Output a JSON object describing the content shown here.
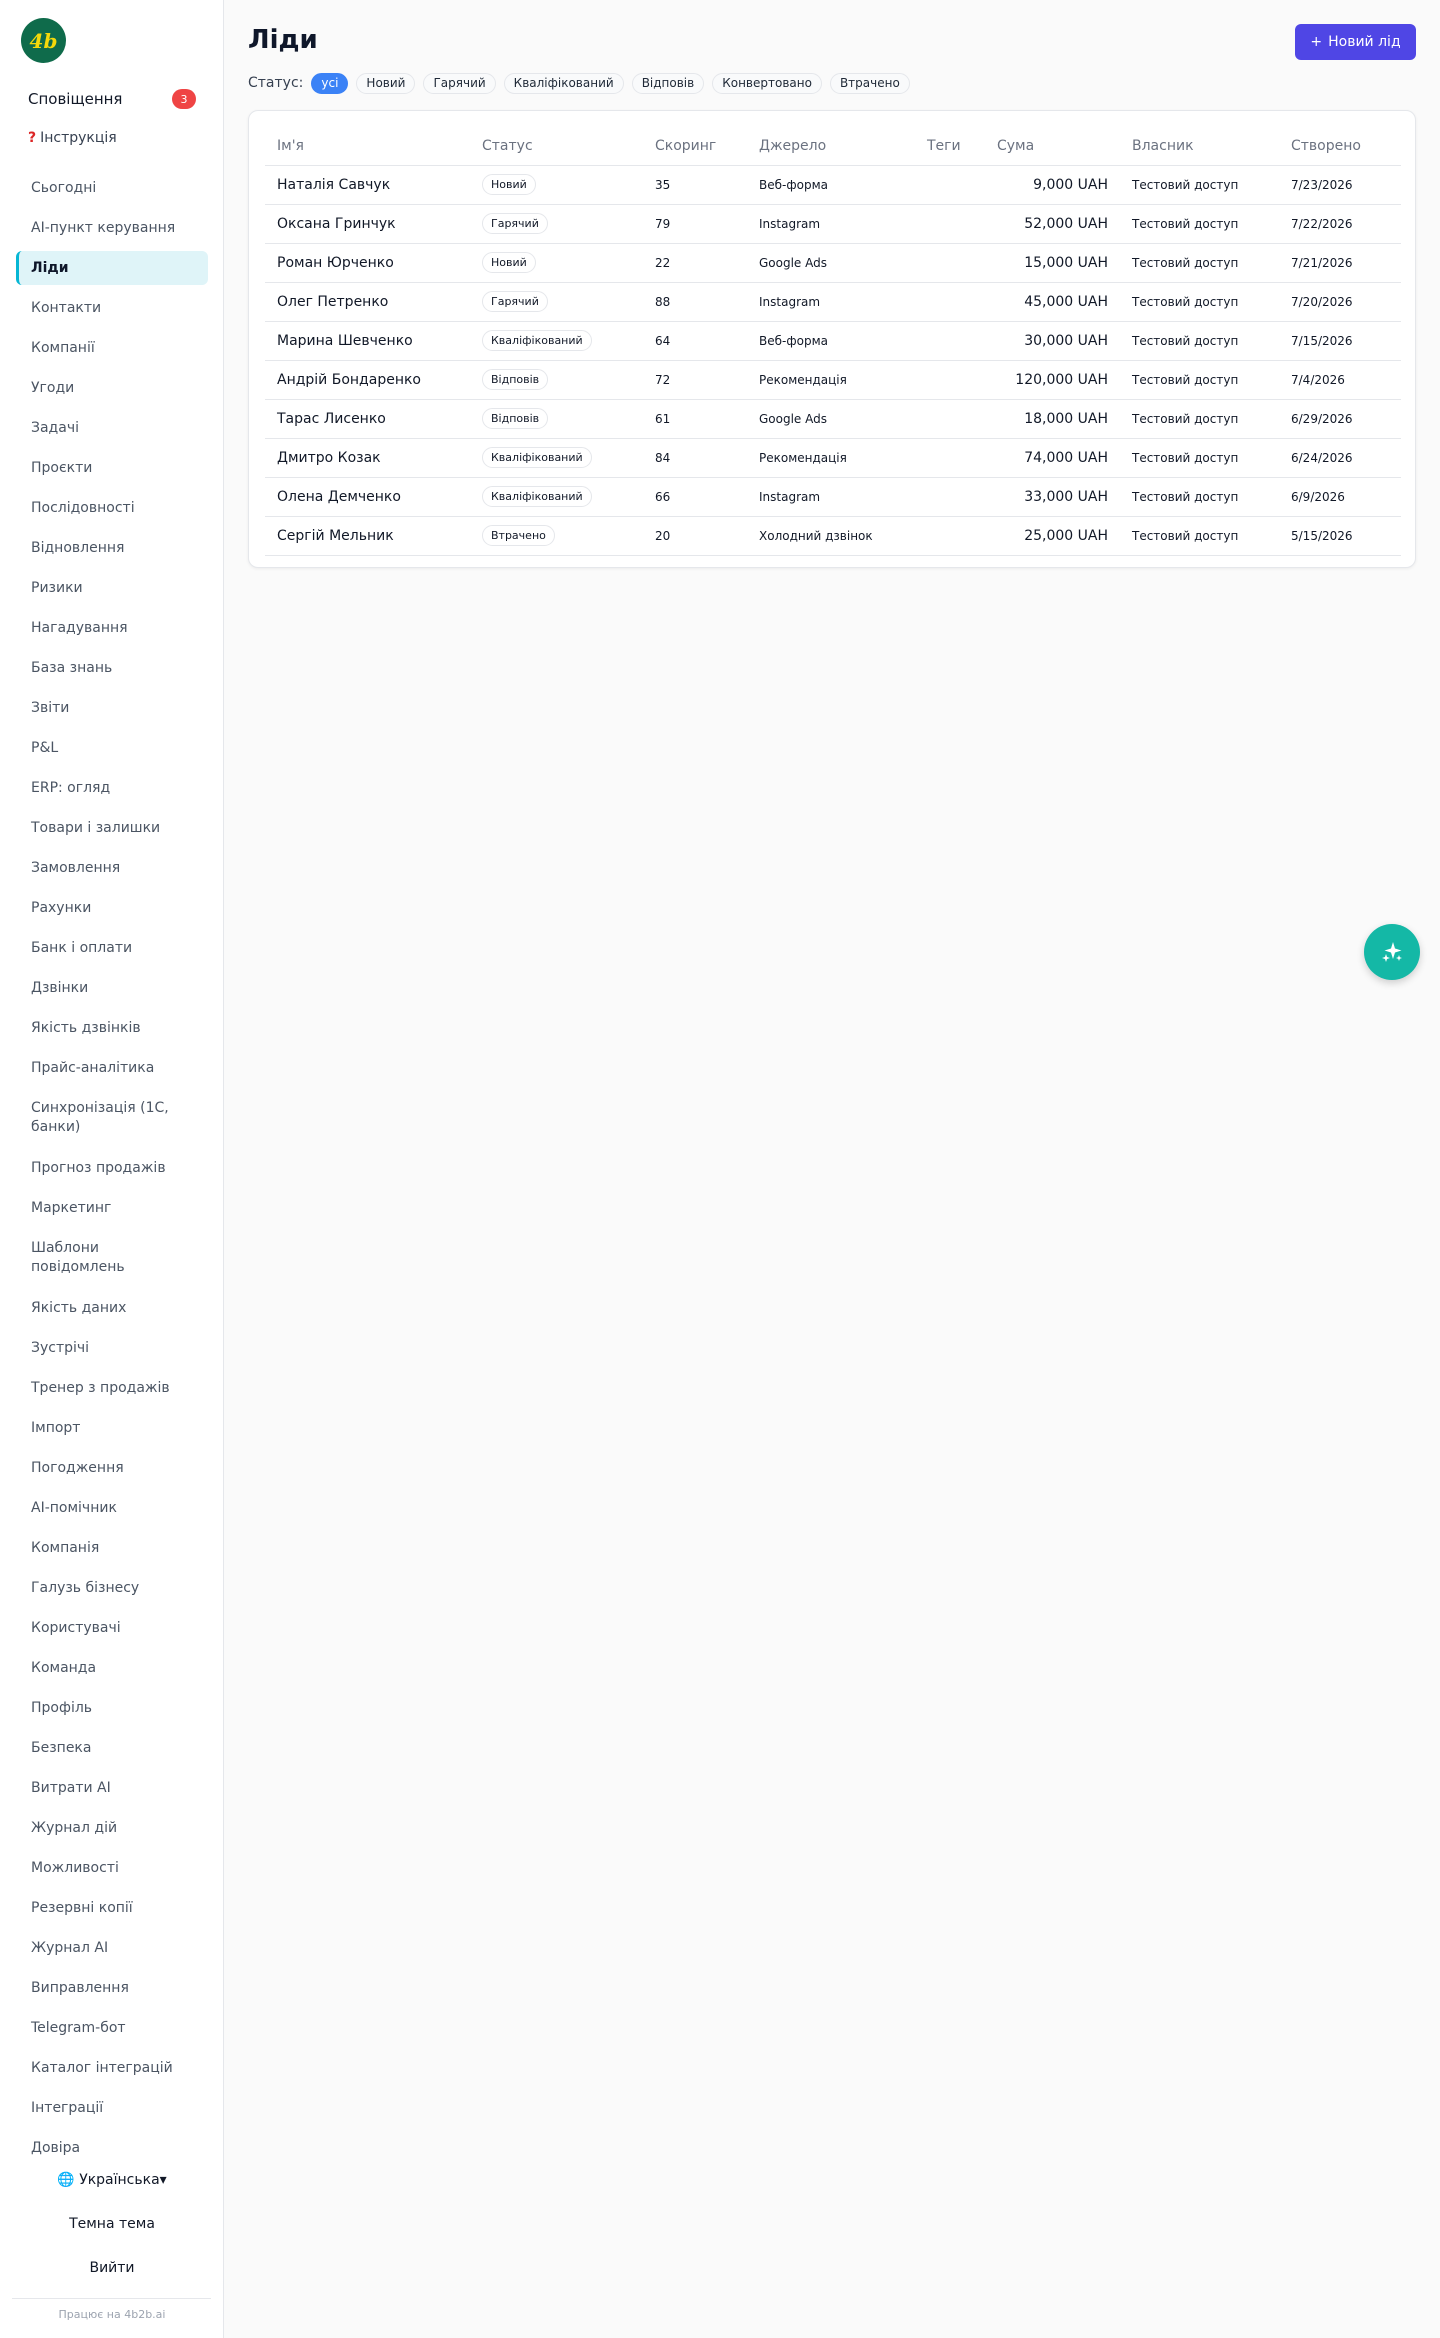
{
  "sidebar": {
    "logo_text": "4b",
    "notifications_label": "Сповіщення",
    "notifications_count": "3",
    "instruction_icon": "?",
    "instruction_label": "Інструкція",
    "items": [
      {
        "label": "Сьогодні"
      },
      {
        "label": "AI-пункт керування"
      },
      {
        "label": "Ліди",
        "active": true
      },
      {
        "label": "Контакти"
      },
      {
        "label": "Компанії"
      },
      {
        "label": "Угоди"
      },
      {
        "label": "Задачі"
      },
      {
        "label": "Проєкти"
      },
      {
        "label": "Послідовності"
      },
      {
        "label": "Відновлення"
      },
      {
        "label": "Ризики"
      },
      {
        "label": "Нагадування"
      },
      {
        "label": "База знань"
      },
      {
        "label": "Звіти"
      },
      {
        "label": "P&L"
      },
      {
        "label": "ERP: огляд"
      },
      {
        "label": "Товари і залишки"
      },
      {
        "label": "Замовлення"
      },
      {
        "label": "Рахунки"
      },
      {
        "label": "Банк і оплати"
      },
      {
        "label": "Дзвінки"
      },
      {
        "label": "Якість дзвінків"
      },
      {
        "label": "Прайс-аналітика"
      },
      {
        "label": "Синхронізація (1С, банки)"
      },
      {
        "label": "Прогноз продажів"
      },
      {
        "label": "Маркетинг"
      },
      {
        "label": "Шаблони повідомлень"
      },
      {
        "label": "Якість даних"
      },
      {
        "label": "Зустрічі"
      },
      {
        "label": "Тренер з продажів"
      },
      {
        "label": "Імпорт"
      },
      {
        "label": "Погодження"
      },
      {
        "label": "AI-помічник"
      },
      {
        "label": "Компанія"
      },
      {
        "label": "Галузь бізнесу"
      },
      {
        "label": "Користувачі"
      },
      {
        "label": "Команда"
      },
      {
        "label": "Профіль"
      },
      {
        "label": "Безпека"
      },
      {
        "label": "Витрати AI"
      },
      {
        "label": "Журнал дій"
      },
      {
        "label": "Можливості"
      },
      {
        "label": "Резервні копії"
      },
      {
        "label": "Журнал AI"
      },
      {
        "label": "Виправлення"
      },
      {
        "label": "Telegram-бот"
      },
      {
        "label": "Каталог інтеграцій"
      },
      {
        "label": "Інтеграції"
      },
      {
        "label": "Довіра"
      }
    ],
    "language_label": "Українська",
    "theme_label": "Темна тема",
    "logout_label": "Вийти",
    "powered_by": "Працює на 4b2b.ai"
  },
  "header": {
    "title": "Ліди",
    "new_button_label": "Новий лід",
    "status_label": "Статус:",
    "filters": [
      {
        "label": "усі",
        "active": true
      },
      {
        "label": "Новий"
      },
      {
        "label": "Гарячий"
      },
      {
        "label": "Кваліфікований"
      },
      {
        "label": "Відповів"
      },
      {
        "label": "Конвертовано"
      },
      {
        "label": "Втрачено"
      }
    ]
  },
  "table": {
    "columns": [
      "Ім'я",
      "Статус",
      "Скоринг",
      "Джерело",
      "Теги",
      "Сума",
      "Власник",
      "Створено"
    ],
    "rows": [
      {
        "name": "Наталія Савчук",
        "status": "Новий",
        "score": "35",
        "source": "Веб-форма",
        "tags": "",
        "amount": "9,000 UAH",
        "owner": "Тестовий доступ",
        "created": "7/23/2026"
      },
      {
        "name": "Оксана Гринчук",
        "status": "Гарячий",
        "score": "79",
        "source": "Instagram",
        "tags": "",
        "amount": "52,000 UAH",
        "owner": "Тестовий доступ",
        "created": "7/22/2026"
      },
      {
        "name": "Роман Юрченко",
        "status": "Новий",
        "score": "22",
        "source": "Google Ads",
        "tags": "",
        "amount": "15,000 UAH",
        "owner": "Тестовий доступ",
        "created": "7/21/2026"
      },
      {
        "name": "Олег Петренко",
        "status": "Гарячий",
        "score": "88",
        "source": "Instagram",
        "tags": "",
        "amount": "45,000 UAH",
        "owner": "Тестовий доступ",
        "created": "7/20/2026"
      },
      {
        "name": "Марина Шевченко",
        "status": "Кваліфікований",
        "score": "64",
        "source": "Веб-форма",
        "tags": "",
        "amount": "30,000 UAH",
        "owner": "Тестовий доступ",
        "created": "7/15/2026"
      },
      {
        "name": "Андрій Бондаренко",
        "status": "Відповів",
        "score": "72",
        "source": "Рекомендація",
        "tags": "",
        "amount": "120,000 UAH",
        "owner": "Тестовий доступ",
        "created": "7/4/2026"
      },
      {
        "name": "Тарас Лисенко",
        "status": "Відповів",
        "score": "61",
        "source": "Google Ads",
        "tags": "",
        "amount": "18,000 UAH",
        "owner": "Тестовий доступ",
        "created": "6/29/2026"
      },
      {
        "name": "Дмитро Козак",
        "status": "Кваліфікований",
        "score": "84",
        "source": "Рекомендація",
        "tags": "",
        "amount": "74,000 UAH",
        "owner": "Тестовий доступ",
        "created": "6/24/2026"
      },
      {
        "name": "Олена Демченко",
        "status": "Кваліфікований",
        "score": "66",
        "source": "Instagram",
        "tags": "",
        "amount": "33,000 UAH",
        "owner": "Тестовий доступ",
        "created": "6/9/2026"
      },
      {
        "name": "Сергій Мельник",
        "status": "Втрачено",
        "score": "20",
        "source": "Холодний дзвінок",
        "tags": "",
        "amount": "25,000 UAH",
        "owner": "Тестовий доступ",
        "created": "5/15/2026"
      }
    ]
  },
  "icons": {
    "fab": "sparkles-icon",
    "language": "globe-icon"
  },
  "colors": {
    "accent": "#4f46e5",
    "filter_active": "#3b82f6",
    "nav_active_bg": "#dff4f8",
    "nav_active_border": "#06b6d4",
    "badge": "#ef4444",
    "fab": "#14b8a6",
    "logo_bg": "#0f6b4b"
  }
}
